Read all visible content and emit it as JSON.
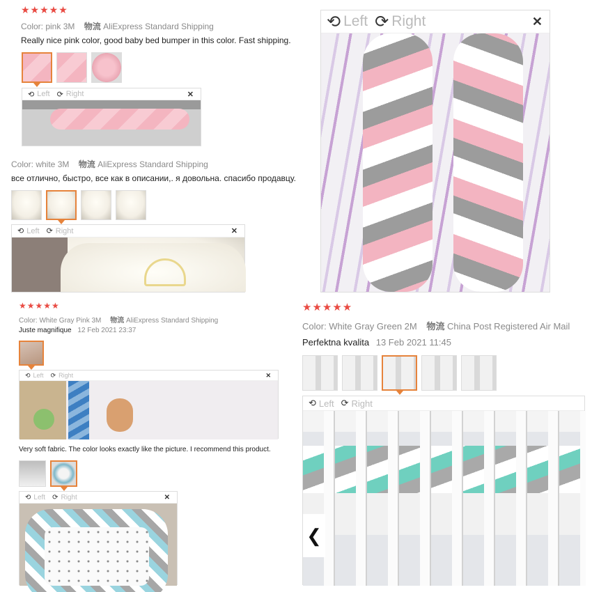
{
  "review1": {
    "stars": "★★★★★",
    "color": "Color: pink 3M",
    "ship_label": "物流",
    "ship": "AliExpress Standard Shipping",
    "text": "Really nice pink color, good baby bed bumper in this color. Fast shipping.",
    "thumb_count": 3,
    "viewer": {
      "left": "Left",
      "right": "Right",
      "close": "✕"
    }
  },
  "review2": {
    "color": "Color: white 3M",
    "ship_label": "物流",
    "ship": "AliExpress Standard Shipping",
    "text": "все отлично, быстро, все как в описании,. я довольна. спасибо продавцу.",
    "viewer": {
      "left": "Left",
      "right": "Right",
      "close": "✕"
    }
  },
  "big_viewer": {
    "left": "Left",
    "right": "Right",
    "close": "✕"
  },
  "review3": {
    "stars": "★★★★★",
    "color": "Color: White Gray Pink 3M",
    "ship_label": "物流",
    "ship": "AliExpress Standard Shipping",
    "text": "Juste magnifique",
    "date": "12 Feb 2021 23:37",
    "viewer": {
      "left": "Left",
      "right": "Right",
      "close": "✕"
    },
    "text2": "Very soft fabric. The color looks exactly like the picture. I recommend this product.",
    "viewer2": {
      "left": "Left",
      "right": "Right",
      "close": "✕"
    }
  },
  "review4": {
    "stars": "★★★★★",
    "color": "Color: White Gray Green 2M",
    "ship_label": "物流",
    "ship": "China Post Registered Air Mail",
    "text": "Perfektna kvalita",
    "date": "13 Feb 2021 11:45",
    "viewer": {
      "left": "Left",
      "right": "Right"
    },
    "prev_icon": "❮"
  },
  "colors": {
    "star": "#e94b43",
    "accent": "#e6833b"
  }
}
